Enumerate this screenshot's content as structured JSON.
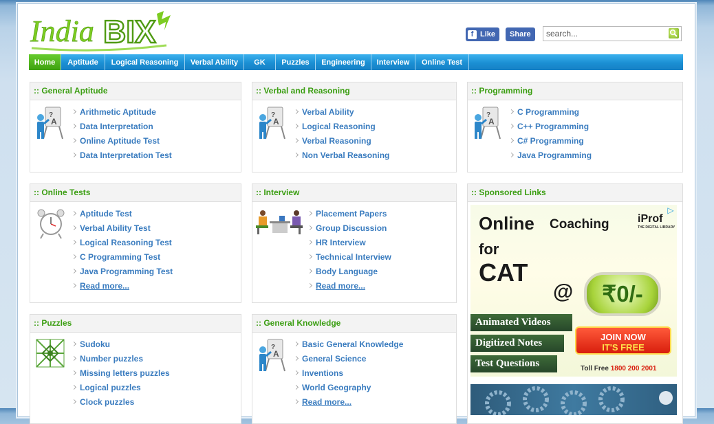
{
  "header": {
    "logo_text": "IndiaBIX",
    "fb_like": "Like",
    "fb_share": "Share",
    "search_placeholder": "search..."
  },
  "nav": [
    "Home",
    "Aptitude",
    "Logical Reasoning",
    "Verbal Ability",
    "GK",
    "Puzzles",
    "Engineering",
    "Interview",
    "Online Test"
  ],
  "panels": {
    "general_aptitude": {
      "title": ":: General Aptitude",
      "links": [
        "Arithmetic Aptitude",
        "Data Interpretation",
        "Online Aptitude Test",
        "Data Interpretation Test"
      ]
    },
    "verbal_reasoning": {
      "title": ":: Verbal and Reasoning",
      "links": [
        "Verbal Ability",
        "Logical Reasoning",
        "Verbal Reasoning",
        "Non Verbal Reasoning"
      ]
    },
    "programming": {
      "title": ":: Programming",
      "links": [
        "C Programming",
        "C++ Programming",
        "C# Programming",
        "Java Programming"
      ]
    },
    "online_tests": {
      "title": ":: Online Tests",
      "links": [
        "Aptitude Test",
        "Verbal Ability Test",
        "Logical Reasoning Test",
        "C Programming Test",
        "Java Programming Test"
      ],
      "more": "Read more..."
    },
    "interview": {
      "title": ":: Interview",
      "links": [
        "Placement Papers",
        "Group Discussion",
        "HR Interview",
        "Technical Interview",
        "Body Language"
      ],
      "more": "Read more..."
    },
    "sponsored": {
      "title": ":: Sponsored Links"
    },
    "puzzles": {
      "title": ":: Puzzles",
      "links": [
        "Sudoku",
        "Number puzzles",
        "Missing letters puzzles",
        "Logical puzzles",
        "Clock puzzles"
      ]
    },
    "general_knowledge": {
      "title": ":: General Knowledge",
      "links": [
        "Basic General Knowledge",
        "General Science",
        "Inventions",
        "World Geography"
      ],
      "more": "Read more..."
    }
  },
  "ad": {
    "line1a": "Online",
    "line1b": "Coaching",
    "line2": "for",
    "line3": "CAT",
    "at": "@",
    "price": "₹0/-",
    "brand": "iProf",
    "brand_sub": "THE DIGITAL LIBRARY",
    "strips": [
      "Animated Videos",
      "Digitized Notes",
      "Test Questions"
    ],
    "join1": "JOIN NOW",
    "join2": "IT'S FREE",
    "tollfree_label": "Toll Free",
    "tollfree_number": "1800 200 2001",
    "ad_choice": "▷"
  },
  "colors": {
    "nav_blue": "#1b8fd3",
    "nav_active": "#4aad17",
    "link_blue": "#3a7cbf",
    "title_green": "#3b9e12"
  }
}
